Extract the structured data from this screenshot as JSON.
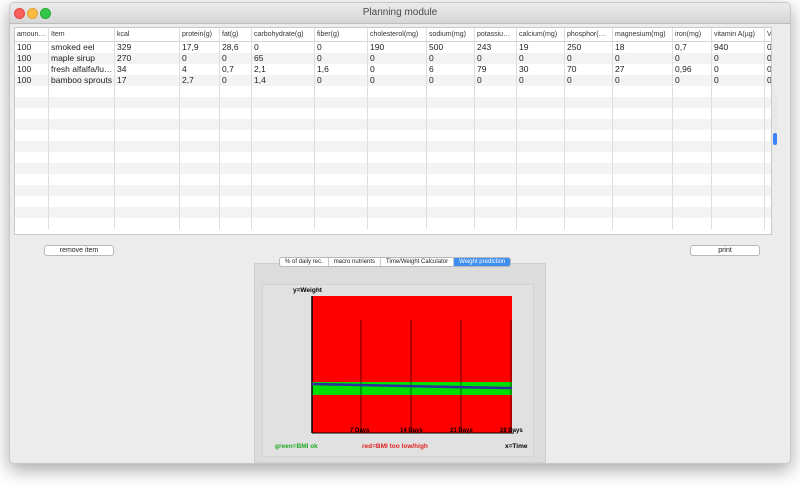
{
  "window": {
    "title": "Planning module"
  },
  "table": {
    "columns": [
      "amoun…",
      "Item",
      "kcal",
      "protein(g)",
      "fat(g)",
      "carbohydrate(g)",
      "fiber(g)",
      "cholesterol(mg)",
      "sodium(mg)",
      "potassiu…",
      "calcium(mg)",
      "phosphor(…",
      "magnesium(mg)",
      "iron(mg)",
      "vitamin A(µg)",
      "V"
    ],
    "rows": [
      [
        "100",
        "smoked eel",
        "329",
        "17,9",
        "28,6",
        "0",
        "0",
        "190",
        "500",
        "243",
        "19",
        "250",
        "18",
        "0,7",
        "940",
        "0"
      ],
      [
        "100",
        "maple sirup",
        "270",
        "0",
        "0",
        "65",
        "0",
        "0",
        "0",
        "0",
        "0",
        "0",
        "0",
        "0",
        "0",
        "0"
      ],
      [
        "100",
        "fresh alfalfa/lu…",
        "34",
        "4",
        "0,7",
        "2,1",
        "1,6",
        "0",
        "6",
        "79",
        "30",
        "70",
        "27",
        "0,96",
        "0",
        "0"
      ],
      [
        "100",
        "bamboo sprouts",
        "17",
        "2,7",
        "0",
        "1,4",
        "0",
        "0",
        "0",
        "0",
        "0",
        "0",
        "0",
        "0",
        "0",
        "0"
      ]
    ]
  },
  "buttons": {
    "remove_item": "remove item",
    "print": "print"
  },
  "tabs": [
    {
      "label": "% of daily rec.",
      "active": false
    },
    {
      "label": "macro nutrients",
      "active": false
    },
    {
      "label": "Time/Weight Calculator",
      "active": false
    },
    {
      "label": "Weight prediction",
      "active": true
    }
  ],
  "chart_data": {
    "type": "line",
    "ylabel": "y=Weight",
    "xlabel": "x=Time",
    "x_ticks": [
      "7 Days",
      "14 Days",
      "21 Days",
      "28 Days"
    ],
    "legend": {
      "green": "green=BMI ok",
      "red": "red=BMI too low/high"
    },
    "colors": {
      "bmi_bad": "#ff0000",
      "bmi_ok": "#00e000",
      "weight_line": "#3030a0",
      "legend_green": "#22aa22",
      "legend_red": "#e02020"
    }
  }
}
